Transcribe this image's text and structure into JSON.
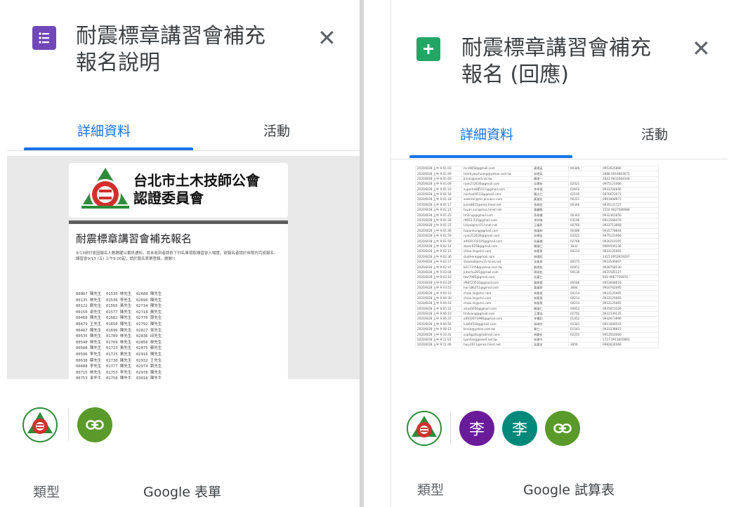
{
  "left": {
    "title_line1": "耐震標章講習會補充",
    "title_line2": "報名說明",
    "close_glyph": "✕",
    "tabs": {
      "details": "詳細資料",
      "activity": "活動"
    },
    "preview": {
      "org_name_line1": "台北市土木技師公會",
      "org_name_line2": "認證委員會",
      "form_title": "耐震標章講習會補充報名",
      "form_description": "9/13研討會因報名人數踴躍以書訊通知，尚未收到者請依下列名單領取講習會入場證，欲報名者請於時限內完成報名，講習會9/13 (五) 上午9:00起，請於報名表單登錄。謝謝!!",
      "roster_lines": [
        "00087 陳先生  01535 林先生  02680 陳先生",
        "00135 林先生  01536 李先生  02696 陳先生",
        "00122 劉先生  01565 黃先生  02734 陳先生",
        "00150 卓先生  01577 陳先生  02718 黃先生",
        "00468 陳先生  01682 陳先生  02770 周先生",
        "00479 王先生  01650 陳先生  02792 陳先生",
        "00487 陳先生  01696 陳先生  02827 吳先生",
        "00535 陳先生  01709 林先生  02836 邱先生",
        "00540 林先生  01709 林先生  02856 林先生",
        "00588 陳先生  01723 黃先生  02875 蔡先生",
        "00596 李先生  01725 黃先生  02916 陳先生",
        "00638 蔡先生  01730 陳先生  02932 王先生",
        "00688 李先生  01777 陳先生  02974 劉先生",
        "00715 林先生  01753 李先生  02978 陳先生",
        "00753 卓先生  01758 陳先生  03018 陳先生"
      ]
    },
    "meta": {
      "type_label": "類型",
      "type_value": "Google 表單"
    }
  },
  "right": {
    "title_line1": "耐震標章講習會補充",
    "title_line2": "報名 (回應)",
    "close_glyph": "✕",
    "tabs": {
      "details": "詳細資料",
      "activity": "活動"
    },
    "sheet_rows": [
      [
        "2020/8/28 上午 9:01:03",
        "mrs9058@gmail.com",
        "黃總英",
        "00346",
        "0952625890"
      ],
      [
        "2020/8/28 上午 9:01:09",
        "hsiehyaochuang@yahoo.com.tw",
        "林總英",
        "",
        "2888 0919683075"
      ],
      [
        "2020/8/28 上午 9:01:09",
        "jimmi@seed.net.tw",
        "陳建一",
        "",
        "2843 0933584546"
      ],
      [
        "2020/8/28 上午 9:01:09",
        "ryan212630@gmail.com",
        "吳標宏",
        "02021",
        "0975121066"
      ],
      [
        "2020/8/28 上午 9:01:10",
        "superhe885117@gmail.com",
        "李季德",
        "02652",
        "0933704856"
      ],
      [
        "2020/8/28 上午 9:01:18",
        "michael0513@gmail.com",
        "陳志仁",
        "02105",
        "0976672071"
      ],
      [
        "2020/8/28 上午 9:01:18",
        "asekirer@ms.pinnacc.com",
        "黃進宏",
        "00221",
        "0961808971"
      ],
      [
        "2020/8/28 上午 9:01:17",
        "juice8815@msa.hinet.net",
        "張崎宏",
        "00346",
        "0935121727"
      ],
      [
        "2020/8/28 上午 9:01:21",
        "tuyan.sun@msa.hinet.net",
        "黃麗雁",
        "",
        "1516 0027588088"
      ],
      [
        "2020/8/28 上午 9:01:25",
        "tm2cup@gmail.com",
        "孫易儒",
        "00342",
        "0932361656"
      ],
      [
        "2020/8/28 上午 9:01:28",
        "r9653-230@gmail.com",
        "李欣梅",
        "03196",
        "0912568476"
      ],
      [
        "2020/8/28 上午 9:01:37",
        "Lhiosi@ms15.hinet.net",
        "王議章",
        "00760",
        "0933713668"
      ],
      [
        "2020/8/28 上午 9:01:46",
        "hzpanhung@gmail.com",
        "張議和",
        "00486",
        "0935778664"
      ],
      [
        "2020/8/28 上午 9:01:59",
        "ryan212630@gmail.com",
        "吳標宏",
        "02021",
        "0975121066"
      ],
      [
        "2020/8/28 上午 9:01:59",
        "a0930310105@gmail.com",
        "吳義儒",
        "02768",
        "0930310105"
      ],
      [
        "2020/8/28 上午 9:02:14",
        "sboer0258@gmail.com",
        "陳國仁",
        "3832",
        "0969506136"
      ],
      [
        "2020/8/28 上午 9:02:15",
        "chiao.lin@ctci.com",
        "林喬青",
        "00214",
        "0933125065"
      ],
      [
        "2020/8/28 上午 9:02:36",
        "ckuthere@gmail.com",
        "林國銘",
        "",
        "1415 0952929297"
      ],
      [
        "2020/8/28 上午 9:02:37",
        "steweall@ms15.hinet.net",
        "沈美青",
        "00575",
        "0933540607"
      ],
      [
        "2020/8/28 上午 9:02:47",
        "b2173558@yahoo.com.tw",
        "劉政佑",
        "02872",
        "0938768530"
      ],
      [
        "2020/8/28 上午 9:03:04",
        "jutechu265@gmail.com",
        "周政佑",
        "00136",
        "0935581127"
      ],
      [
        "2020/8/28 上午 9:03:10",
        "twe7985@gmail.com",
        "吳嘉仁",
        "",
        "920 0967759970"
      ],
      [
        "2020/8/28 上午 9:03:29",
        "d98723516@gmail.com",
        "黃勝喜",
        "00586",
        "0953608616"
      ],
      [
        "2020/8/28 上午 9:03:53",
        "hun186251@gmail.com",
        "黃議章",
        "3684",
        "0916762095"
      ],
      [
        "2020/8/28 上午 9:04:10",
        "chiao.lin@ctci.com",
        "林喬青",
        "00214",
        "0933125065"
      ],
      [
        "2020/8/28 上午 9:04:30",
        "chiao.lin@ctci.com",
        "林喬青",
        "00214",
        "0933125065"
      ],
      [
        "2020/8/28 上午 9:04:43",
        "chiao.lin@ctci.com",
        "林喬青",
        "00214",
        "0933125065"
      ],
      [
        "2020/8/28 上午 9:05:22",
        "alrus0056@gmail.com",
        "陳國仁",
        "00652",
        "0935653109"
      ],
      [
        "2020/8/28 上午 9:06:10",
        "tmkuang@gmail.com",
        "王惠忠",
        "02702",
        "0932339125"
      ],
      [
        "2020/8/28 上午 9:06:37",
        "a0932673996@gmail.com",
        "李書鈞",
        "01452",
        "0932673996"
      ],
      [
        "2020/8/28 上午 9:06:56",
        "luiz64518@gmail.com",
        "林崎宗",
        "02341",
        "0911606541"
      ],
      [
        "2020/8/28 上午 9:08:15",
        "ksssk@yahoo.com.tw",
        "陳仁一",
        "01543",
        "0933338815"
      ],
      [
        "2020/8/28 上午 9:10:41",
        "copf@ptlv@hotmail.com",
        "林慶宏",
        "02255",
        "0953563060"
      ],
      [
        "2020/8/28 上午 9:11:01",
        "lyanliang@seed.net.tw",
        "林建中",
        "",
        "1727 0913605860"
      ],
      [
        "2020/8/28 上午 9:11:46",
        "huiy2011@msa.hinet.net",
        "吳嘉忠",
        "3856",
        "0982624066"
      ]
    ],
    "avatars": {
      "avatar1_initial": "李",
      "avatar2_initial": "李"
    },
    "meta": {
      "type_label": "類型",
      "type_value": "Google 試算表"
    }
  },
  "colors": {
    "forms_purple": "#7248b9",
    "sheets_green": "#23a566",
    "link_green": "#5a9a2a",
    "avatar_purple": "#6a1b9a",
    "avatar_teal": "#00897b",
    "tab_blue": "#1a73e8"
  }
}
